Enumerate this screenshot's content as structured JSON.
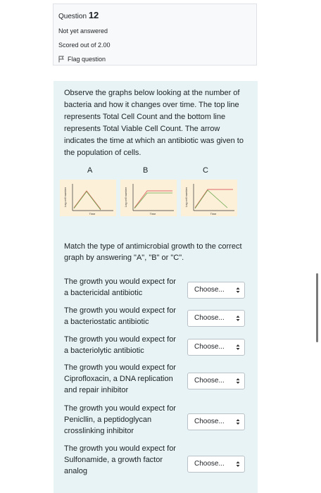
{
  "question_info": {
    "label": "Question",
    "number": "12",
    "status": "Not yet answered",
    "score": "Scored out of 2.00",
    "flag_label": "Flag question"
  },
  "question": {
    "text": "Observe the graphs below looking at the number of bacteria and how it changes over time. The top line represents Total Cell Count and the bottom line represents Total Viable Cell Count. The arrow indicates the time at which an antibiotic was given to the population of cells.",
    "graphs": [
      {
        "letter": "A",
        "ylabel": "Log cell number",
        "xlabel": "Time"
      },
      {
        "letter": "B",
        "ylabel": "Log cell number",
        "xlabel": "Time"
      },
      {
        "letter": "C",
        "ylabel": "Log cell number",
        "xlabel": "Time"
      }
    ],
    "prompt": "Match the type of antimicrobial growth to the correct graph by answering \"A\", \"B\" or \"C\"."
  },
  "matches": [
    {
      "label": "The growth you would expect for a bactericidal antibiotic",
      "selected": "Choose..."
    },
    {
      "label": "The growth you would expect for a bacteriostatic antibiotic",
      "selected": "Choose..."
    },
    {
      "label": "The growth you would expect for a bacteriolytic antibiotic",
      "selected": "Choose..."
    },
    {
      "label": "The growth you would expect for Ciprofloxacin, a DNA replication and repair inhibitor",
      "selected": "Choose..."
    },
    {
      "label": "The growth you would expect for Penicllin, a peptidoglycan crosslinking inhibitor",
      "selected": "Choose..."
    },
    {
      "label": "The growth you would expect for Sulfonamide, a growth factor analog",
      "selected": "Choose..."
    }
  ],
  "colors": {
    "total_line": "#e06666",
    "viable_line": "#6aa84f",
    "graph_bg": "#fdf0d8"
  }
}
